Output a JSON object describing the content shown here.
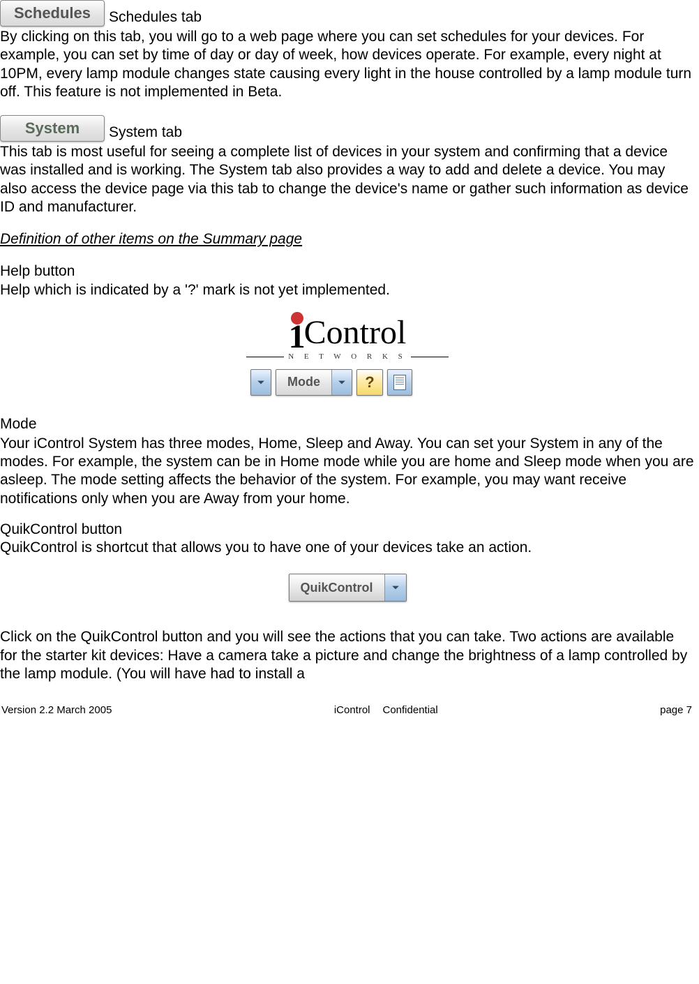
{
  "tabs": {
    "schedules": {
      "button_text": "Schedules",
      "label": "Schedules tab"
    },
    "system": {
      "button_text": "System",
      "label": "System tab"
    }
  },
  "schedules_para": "By clicking on this tab, you will go to a web page where you can set schedules for your devices.  For example, you can set by time of day or day of week, how devices operate.  For example, every night at 10PM, every lamp module changes state causing every light in the house controlled by a lamp module turn off.  This feature is not implemented in Beta.",
  "system_para": "This tab is most useful for seeing a complete list of devices in your system and confirming that a device was installed and is working.  The System tab also provides a way to add and delete a device.  You may also access the device page via this tab to change the device's name or gather such information as device ID and manufacturer.",
  "definition_heading": "Definition of other items on the Summary page",
  "help": {
    "heading": "Help button",
    "text": "Help which is indicated by a '?' mark is not yet implemented."
  },
  "logo": {
    "brand_text": "Control",
    "networks_text": "N E T W O R K S",
    "mode_label": "Mode",
    "help_symbol": "?"
  },
  "mode": {
    "heading": "Mode",
    "text": "Your iControl System has three modes, Home, Sleep and Away.   You can set your System in any of the modes.  For example, the system can be in Home mode while you are home and Sleep mode when you are asleep.  The mode setting affects the behavior of the system.  For example, you may want receive notifications only when you are Away from your home."
  },
  "quik": {
    "heading": "QuikControl button",
    "intro": "QuikControl is shortcut that allows you to have one of your devices take an action.",
    "button_label": "QuikControl",
    "text": "Click on the QuikControl button and you will see the actions that you can take.  Two actions are available for the starter kit devices:  Have a camera take a picture and change the brightness of a lamp controlled by the lamp module.  (You will have had to install a"
  },
  "footer": {
    "left": "Version 2.2 March 2005",
    "center_a": "iControl",
    "center_b": "Confidential",
    "right": "page 7"
  }
}
